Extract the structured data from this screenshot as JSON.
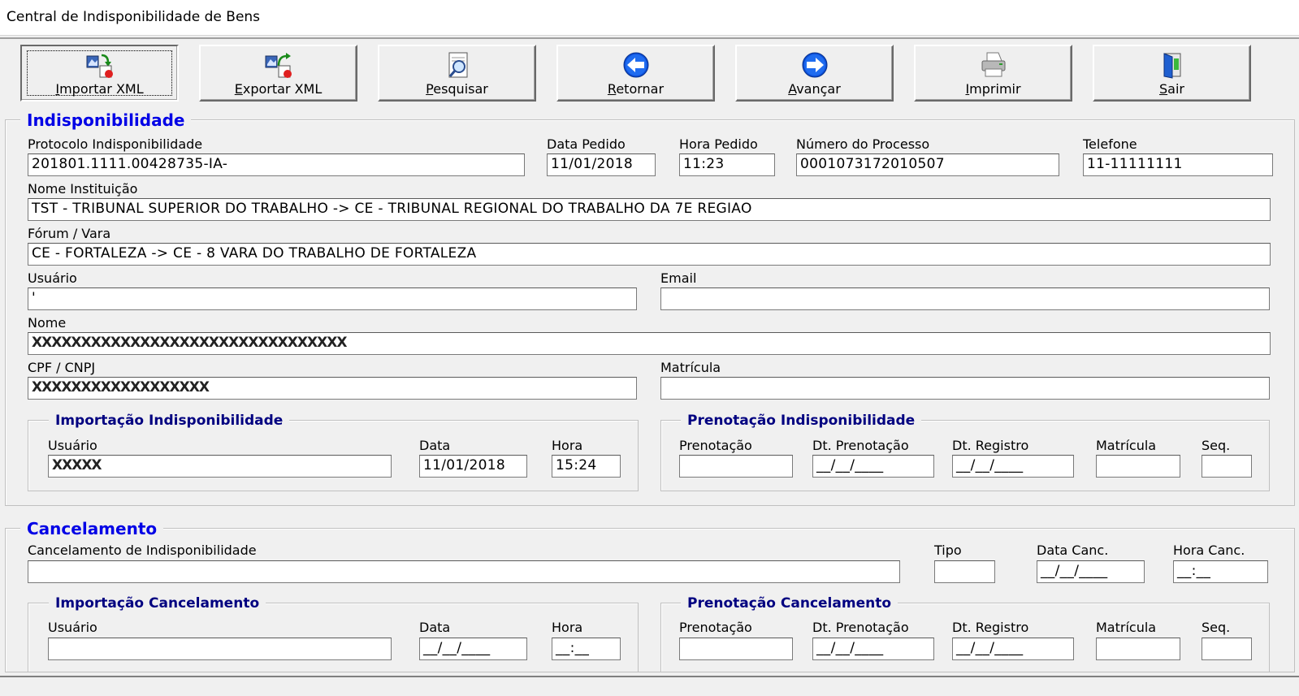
{
  "window": {
    "title": "Central de Indisponibilidade de Bens"
  },
  "toolbar": {
    "importar": "Importar XML",
    "exportar": "Exportar XML",
    "pesquisar": "Pesquisar",
    "retornar": "Retornar",
    "avancar": "Avançar",
    "imprimir": "Imprimir",
    "sair": "Sair"
  },
  "indisponibilidade": {
    "title": "Indisponibilidade",
    "protocolo_label": "Protocolo Indisponibilidade",
    "protocolo_value": "201801.1111.00428735-IA-",
    "data_pedido_label": "Data Pedido",
    "data_pedido_value": "11/01/2018",
    "hora_pedido_label": "Hora Pedido",
    "hora_pedido_value": "11:23",
    "numero_processo_label": "Número do Processo",
    "numero_processo_value": "0001073172010507",
    "telefone_label": "Telefone",
    "telefone_value": "11-11111111",
    "nome_instituicao_label": "Nome Instituição",
    "nome_instituicao_value": "TST - TRIBUNAL SUPERIOR DO TRABALHO -> CE - TRIBUNAL REGIONAL DO TRABALHO DA 7E REGIAO",
    "forum_vara_label": "Fórum / Vara",
    "forum_vara_value": "CE - FORTALEZA -> CE - 8 VARA DO TRABALHO DE FORTALEZA",
    "usuario_label": "Usuário",
    "usuario_value": "'",
    "email_label": "Email",
    "email_value": "",
    "nome_label": "Nome",
    "nome_value": "XXXXXXXXXXXXXXXXXXXXXXXXXXXXXXXX",
    "cpf_label": "CPF / CNPJ",
    "cpf_value": "XXXXXXXXXXXXXXXXXX",
    "matricula_label": "Matrícula",
    "matricula_value": ""
  },
  "importacao_indisp": {
    "title": "Importação Indisponibilidade",
    "usuario_label": "Usuário",
    "usuario_value": "XXXXX",
    "data_label": "Data",
    "data_value": "11/01/2018",
    "hora_label": "Hora",
    "hora_value": "15:24"
  },
  "prenotacao_indisp": {
    "title": "Prenotação Indisponibilidade",
    "prenotacao_label": "Prenotação",
    "prenotacao_value": "",
    "dt_prenotacao_label": "Dt. Prenotação",
    "dt_prenotacao_value": "__/__/____",
    "dt_registro_label": "Dt. Registro",
    "dt_registro_value": "__/__/____",
    "matricula_label": "Matrícula",
    "matricula_value": "",
    "seq_label": "Seq.",
    "seq_value": ""
  },
  "cancelamento": {
    "title": "Cancelamento",
    "canc_label": "Cancelamento de  Indisponibilidade",
    "canc_value": "",
    "tipo_label": "Tipo",
    "tipo_value": "",
    "data_canc_label": "Data Canc.",
    "data_canc_value": "__/__/____",
    "hora_canc_label": "Hora Canc.",
    "hora_canc_value": "__:__"
  },
  "importacao_canc": {
    "title": "Importação Cancelamento",
    "usuario_label": "Usuário",
    "usuario_value": "",
    "data_label": "Data",
    "data_value": "__/__/____",
    "hora_label": "Hora",
    "hora_value": "__:__"
  },
  "prenotacao_canc": {
    "title": "Prenotação Cancelamento",
    "prenotacao_label": "Prenotação",
    "prenotacao_value": "",
    "dt_prenotacao_label": "Dt. Prenotação",
    "dt_prenotacao_value": "__/__/____",
    "dt_registro_label": "Dt. Registro",
    "dt_registro_value": "__/__/____",
    "matricula_label": "Matrícula",
    "matricula_value": "",
    "seq_label": "Seq.",
    "seq_value": ""
  },
  "colors": {
    "group_title": "#0000e6",
    "subgroup_title": "#000080",
    "background": "#f0f0f0"
  },
  "icons": {
    "importar": "import-xml-icon",
    "exportar": "export-xml-icon",
    "pesquisar": "search-document-icon",
    "retornar": "arrow-left-icon",
    "avancar": "arrow-right-icon",
    "imprimir": "printer-icon",
    "sair": "exit-door-icon"
  }
}
